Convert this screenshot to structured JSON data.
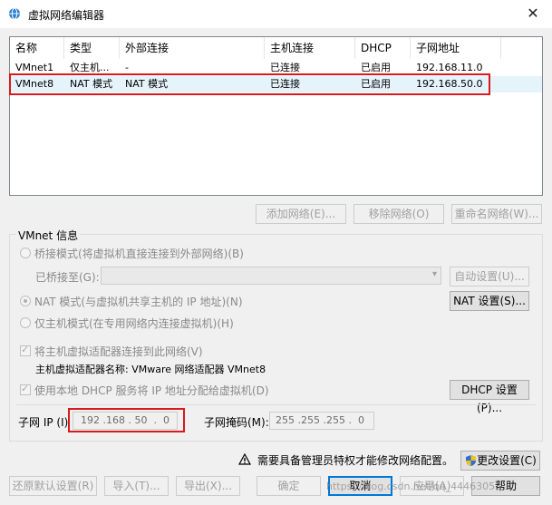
{
  "window": {
    "title": "虚拟网络编辑器",
    "close_glyph": "✕"
  },
  "table": {
    "columns": [
      "名称",
      "类型",
      "外部连接",
      "主机连接",
      "DHCP",
      "子网地址"
    ],
    "rows": [
      [
        "VMnet1",
        "仅主机...",
        "-",
        "已连接",
        "已启用",
        "192.168.11.0"
      ],
      [
        "VMnet8",
        "NAT 模式",
        "NAT 模式",
        "已连接",
        "已启用",
        "192.168.50.0"
      ]
    ],
    "selected_row": 1
  },
  "table_buttons": {
    "add": "添加网络(E)...",
    "remove": "移除网络(O)",
    "rename": "重命名网络(W)..."
  },
  "vmnet_info": {
    "label": "VMnet 信息",
    "bridged": "桥接模式(将虚拟机直接连接到外部网络)(B)",
    "bridged_to_label": "已桥接至(G):",
    "auto_settings": "自动设置(U)...",
    "nat": "NAT 模式(与虚拟机共享主机的 IP 地址)(N)",
    "nat_settings": "NAT 设置(S)...",
    "host_only": "仅主机模式(在专用网络内连接虚拟机)(H)",
    "connect_adapter": "将主机虚拟适配器连接到此网络(V)",
    "adapter_name": "主机虚拟适配器名称: VMware 网络适配器 VMnet8",
    "use_dhcp": "使用本地 DHCP 服务将 IP 地址分配给虚拟机(D)",
    "dhcp_settings": "DHCP 设置(P)...",
    "subnet_ip_label": "子网 IP (I)",
    "subnet_ip": "192 .168 . 50  .  0",
    "subnet_mask_label": "子网掩码(M):",
    "subnet_mask": "255 .255 .255 .  0"
  },
  "footer": {
    "admin_note": "需要具备管理员特权才能修改网络配置。",
    "change_settings": "更改设置(C)",
    "restore_defaults": "还原默认设置(R)",
    "import": "导入(T)...",
    "export": "导出(X)...",
    "ok": "确定",
    "cancel": "取消",
    "apply": "应用(A)",
    "help": "帮助",
    "watermark": "https://blog.csdn.net/qq_44463053"
  },
  "colors": {
    "highlight": "#d9191c",
    "selection": "#e5f3fb",
    "accent": "#0078d7"
  },
  "icons": [
    "network-globe-icon",
    "close-icon",
    "warning-icon",
    "shield-icon",
    "chevron-down-icon"
  ]
}
